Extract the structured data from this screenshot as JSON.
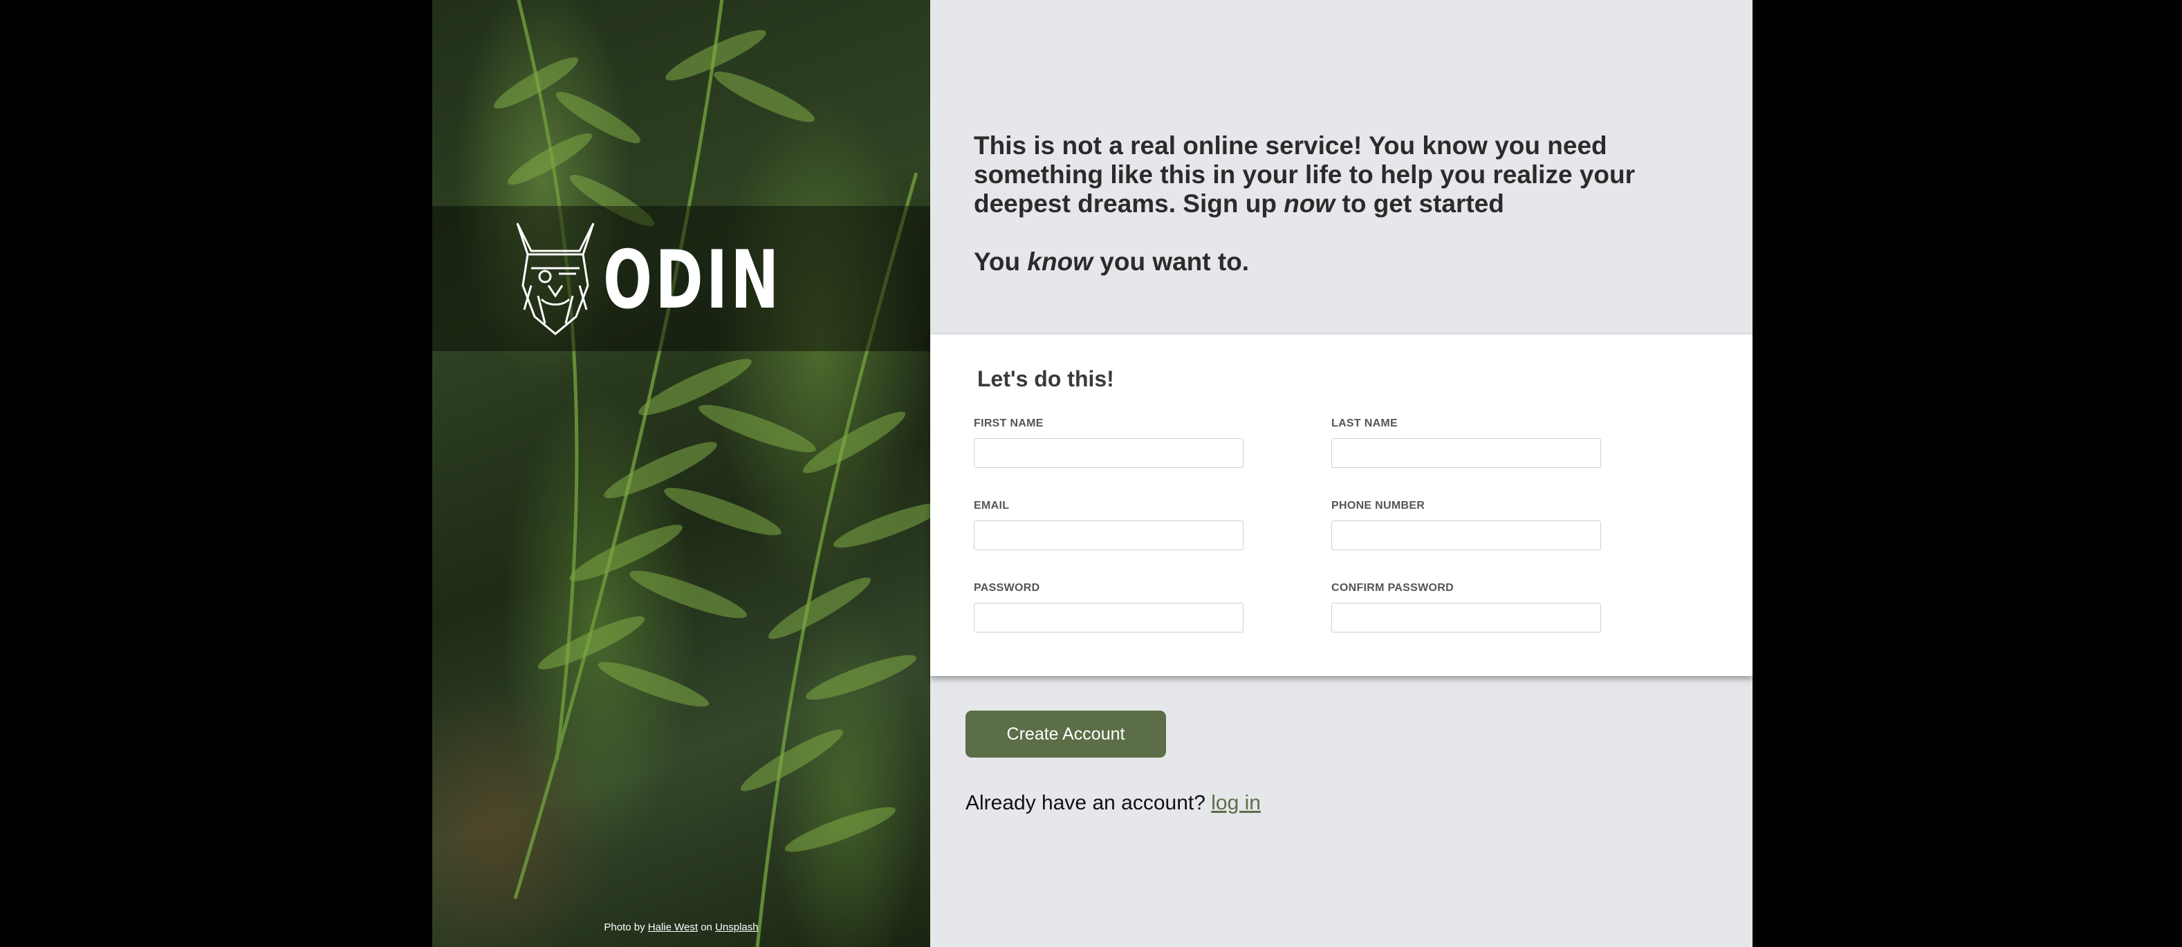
{
  "logo": {
    "text": "ODIN",
    "icon": "viking-head-icon"
  },
  "photo_credit": {
    "prefix": "Photo by",
    "author": "Halie West",
    "middle": "on",
    "site": "Unsplash"
  },
  "intro": {
    "line1_start": "This is not a real online service! You know you need something like this in your life to help you realize your deepest dreams. Sign up",
    "line1_em": "now",
    "line1_end": "to get started",
    "line2_start": "You",
    "line2_em": "know",
    "line2_end": "you want to."
  },
  "form": {
    "title": "Let's do this!",
    "fields": {
      "first_name": {
        "label": "FIRST NAME",
        "value": ""
      },
      "last_name": {
        "label": "LAST NAME",
        "value": ""
      },
      "email": {
        "label": "EMAIL",
        "value": ""
      },
      "phone": {
        "label": "PHONE NUMBER",
        "value": ""
      },
      "password": {
        "label": "PASSWORD",
        "value": ""
      },
      "confirm_password": {
        "label": "CONFIRM PASSWORD",
        "value": ""
      }
    }
  },
  "actions": {
    "create_account": "Create Account",
    "login_prompt": "Already have an account?",
    "login_link": "log in"
  },
  "colors": {
    "accent": "#5b6e47",
    "panel_bg": "#e5e7eb",
    "page_bg": "#000000"
  }
}
